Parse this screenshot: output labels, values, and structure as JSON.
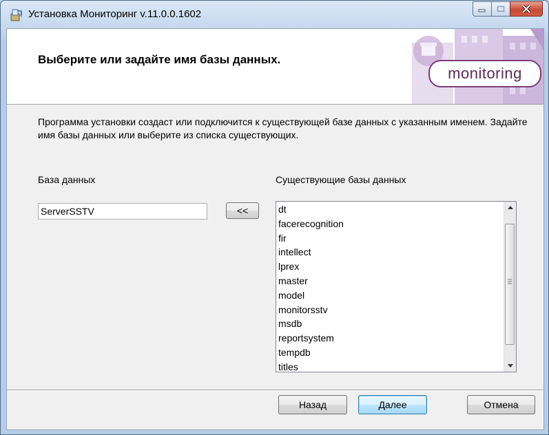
{
  "window": {
    "title": "Установка Мониторинг v.11.0.0.1602",
    "controls": [
      "minimize-icon",
      "maximize-icon",
      "close-icon"
    ]
  },
  "banner": {
    "title": "Выберите или задайте имя базы данных.",
    "logo_text": "monitoring"
  },
  "description": "Программа установки создаст или подключится к существующей базе данных с указанным именем. Задайте имя базы данных или выберите из списка существующих.",
  "database": {
    "label": "База данных",
    "value": "ServerSSTV"
  },
  "copy_button": {
    "label": "<<"
  },
  "existing": {
    "label": "Существующие базы данных",
    "items": [
      "dt",
      "facerecognition",
      "fir",
      "intellect",
      "lprex",
      "master",
      "model",
      "monitorsstv",
      "msdb",
      "reportsystem",
      "tempdb",
      "titles"
    ]
  },
  "buttons": {
    "back": "Назад",
    "next": "Далее",
    "cancel": "Отмена"
  },
  "colors": {
    "accent": "#3c7fb1",
    "logo": "#7c3b77",
    "close": "#c74a36"
  }
}
